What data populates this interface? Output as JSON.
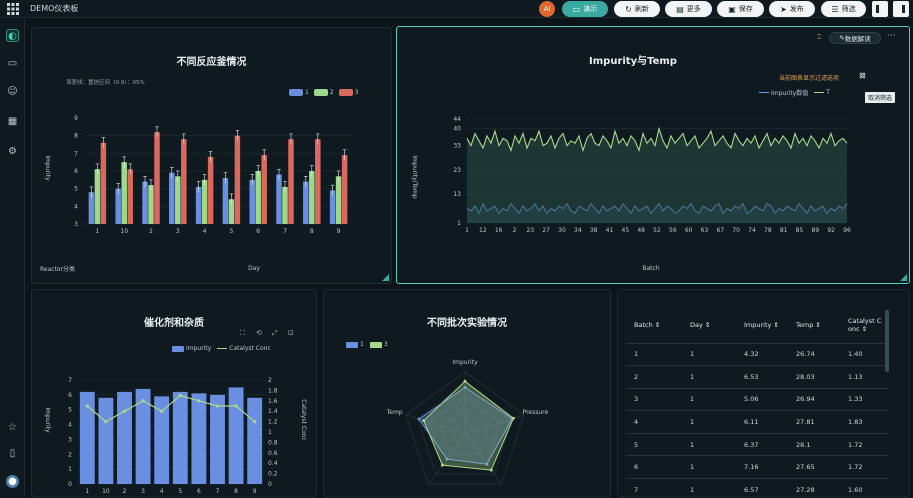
{
  "app": {
    "title": "DEMO仪表板",
    "avatar": "AI"
  },
  "toolbar": {
    "present": "演示",
    "refresh": "刷新",
    "more": "更多",
    "save": "保存",
    "publish": "发布",
    "filter": "筛选"
  },
  "panels": {
    "reactor": {
      "title": "不同反应釜情况",
      "subtitle": "误差线：置信区间（0.9）：95%",
      "legend": [
        "1",
        "2",
        "3"
      ],
      "corner_label": "Reactor分类"
    },
    "impurity_temp": {
      "title": "Impurity与Temp",
      "menu_label": "数据解读",
      "hint": "当前图表显示过滤选项",
      "tooltip": "取消筛选",
      "legend": [
        "Impurity数值",
        "T"
      ]
    },
    "catalyst": {
      "title": "催化剂和杂质",
      "legend": [
        "Impurity",
        "Catalyst Conc"
      ]
    },
    "radar": {
      "title": "不同批次实验情况",
      "legend": [
        "1",
        "3"
      ]
    },
    "table": {
      "columns": [
        "Batch ⇕",
        "Day ⇕",
        "Impurity ⇕",
        "Temp ⇕",
        "Catalyst C onc ⇕"
      ],
      "rows": [
        [
          "1",
          "1",
          "4.32",
          "26.74",
          "1.40"
        ],
        [
          "2",
          "1",
          "6.53",
          "28.03",
          "1.13"
        ],
        [
          "3",
          "1",
          "5.06",
          "26.94",
          "1.33"
        ],
        [
          "4",
          "1",
          "6.11",
          "27.81",
          "1.83"
        ],
        [
          "5",
          "1",
          "6.37",
          "28.1",
          "1.72"
        ],
        [
          "6",
          "1",
          "7.16",
          "27.65",
          "1.72"
        ],
        [
          "7",
          "1",
          "6.57",
          "27.28",
          "1.60"
        ]
      ]
    }
  },
  "chart_data": [
    {
      "type": "bar",
      "title": "不同反应釜情况",
      "subtitle": "误差线：置信区间（0.9）：95%",
      "xlabel": "Day",
      "ylabel": "Impurity",
      "categories": [
        "1",
        "10",
        "2",
        "3",
        "4",
        "5",
        "6",
        "7",
        "8",
        "9"
      ],
      "ylim": [
        3,
        9
      ],
      "yticks": [
        3,
        4,
        5,
        6,
        7,
        8,
        9
      ],
      "series": [
        {
          "name": "1",
          "color": "#6b8fe0",
          "values": [
            4.8,
            5.0,
            5.4,
            5.9,
            5.1,
            5.6,
            5.5,
            5.8,
            5.4,
            4.9
          ],
          "err": [
            0.3,
            0.3,
            0.3,
            0.3,
            0.3,
            0.3,
            0.3,
            0.3,
            0.3,
            0.3
          ]
        },
        {
          "name": "2",
          "color": "#9cd98a",
          "values": [
            6.1,
            6.5,
            5.2,
            5.7,
            5.5,
            4.4,
            6.0,
            5.1,
            6.0,
            5.7
          ],
          "err": [
            0.3,
            0.3,
            0.3,
            0.3,
            0.3,
            0.3,
            0.3,
            0.3,
            0.3,
            0.3
          ]
        },
        {
          "name": "3",
          "color": "#d9685e",
          "values": [
            7.6,
            6.1,
            8.2,
            7.8,
            6.8,
            8.0,
            6.9,
            7.8,
            7.8,
            6.9
          ],
          "err": [
            0.3,
            0.3,
            0.3,
            0.3,
            0.3,
            0.3,
            0.3,
            0.3,
            0.3,
            0.3
          ]
        }
      ]
    },
    {
      "type": "line",
      "title": "Impurity与Temp",
      "xlabel": "Batch",
      "ylabel": "Impurity/Temp",
      "x_ticks": [
        "1",
        "12",
        "16",
        "2",
        "23",
        "27",
        "30",
        "34",
        "38",
        "41",
        "45",
        "48",
        "52",
        "56",
        "60",
        "63",
        "67",
        "70",
        "74",
        "78",
        "81",
        "85",
        "89",
        "92",
        "96"
      ],
      "yticks": [
        1,
        13,
        23,
        33,
        40,
        44
      ],
      "ylim": [
        1,
        44
      ],
      "series": [
        {
          "name": "Impurity数值",
          "color": "#6b9cf2",
          "values": [
            7,
            6,
            8,
            5,
            9,
            6,
            7,
            8,
            5,
            7,
            6,
            9,
            7,
            5,
            8,
            6,
            7,
            9,
            6,
            8,
            5,
            7,
            6,
            8,
            7,
            9,
            6,
            5,
            8,
            7,
            6,
            9,
            7,
            5,
            8,
            6,
            7,
            8,
            6,
            9,
            7,
            5,
            8,
            6,
            7,
            8,
            5,
            7,
            9,
            6,
            8,
            7,
            5,
            6,
            8,
            7,
            9,
            6,
            5,
            8,
            7,
            6,
            8,
            9,
            5,
            7,
            6,
            8,
            7,
            9,
            5,
            6,
            8,
            7,
            6,
            9,
            8,
            5,
            7,
            6,
            8,
            7,
            6,
            9,
            7,
            5,
            8,
            6,
            7,
            8,
            5,
            7,
            6,
            8,
            7,
            9
          ]
        },
        {
          "name": "T",
          "color": "#a9d98a",
          "values": [
            36,
            33,
            38,
            35,
            32,
            37,
            34,
            39,
            33,
            36,
            35,
            31,
            37,
            34,
            38,
            32,
            36,
            35,
            39,
            33,
            34,
            37,
            32,
            36,
            38,
            33,
            35,
            34,
            37,
            31,
            36,
            38,
            34,
            33,
            37,
            35,
            32,
            39,
            34,
            36,
            33,
            37,
            35,
            31,
            38,
            34,
            36,
            33,
            40,
            35,
            32,
            37,
            34,
            36,
            38,
            33,
            35,
            37,
            32,
            34,
            36,
            39,
            33,
            35,
            37,
            34,
            32,
            38,
            35,
            33,
            36,
            34,
            37,
            32,
            35,
            38,
            33,
            36,
            34,
            37,
            35,
            32,
            38,
            34,
            36,
            33,
            37,
            35,
            32,
            36,
            34,
            38,
            33,
            35,
            36,
            34
          ]
        }
      ]
    },
    {
      "type": "bar",
      "title": "催化剂和杂质",
      "ylabel": "Impurity",
      "y2label": "Catalyst Conc",
      "categories": [
        "1",
        "10",
        "2",
        "3",
        "4",
        "5",
        "6",
        "7",
        "8",
        "9"
      ],
      "ylim": [
        0,
        7
      ],
      "y2lim": [
        0,
        2
      ],
      "yticks": [
        0,
        1,
        2,
        3,
        4,
        5,
        6,
        7
      ],
      "y2ticks": [
        0,
        0.2,
        0.4,
        0.6,
        0.8,
        1,
        1.2,
        1.4,
        1.6,
        1.8,
        2
      ],
      "series": [
        {
          "name": "Impurity",
          "color": "#6b8fe0",
          "values": [
            6.2,
            5.8,
            6.2,
            6.4,
            5.9,
            6.2,
            6.1,
            6.0,
            6.5,
            5.8
          ]
        },
        {
          "name": "Catalyst Conc",
          "color": "#a9d98a",
          "type": "line",
          "values": [
            1.5,
            1.2,
            1.4,
            1.6,
            1.4,
            1.7,
            1.6,
            1.5,
            1.5,
            1.2
          ]
        }
      ]
    },
    {
      "type": "radar",
      "title": "不同批次实验情况",
      "axes": [
        "Impurity",
        "Pressure",
        "",
        "",
        "Temp"
      ],
      "series": [
        {
          "name": "1",
          "color": "#6b8fe0",
          "values": [
            0.75,
            0.8,
            0.6,
            0.5,
            0.78
          ]
        },
        {
          "name": "3",
          "color": "#a9d98a",
          "values": [
            0.85,
            0.82,
            0.72,
            0.62,
            0.7
          ]
        }
      ]
    }
  ]
}
